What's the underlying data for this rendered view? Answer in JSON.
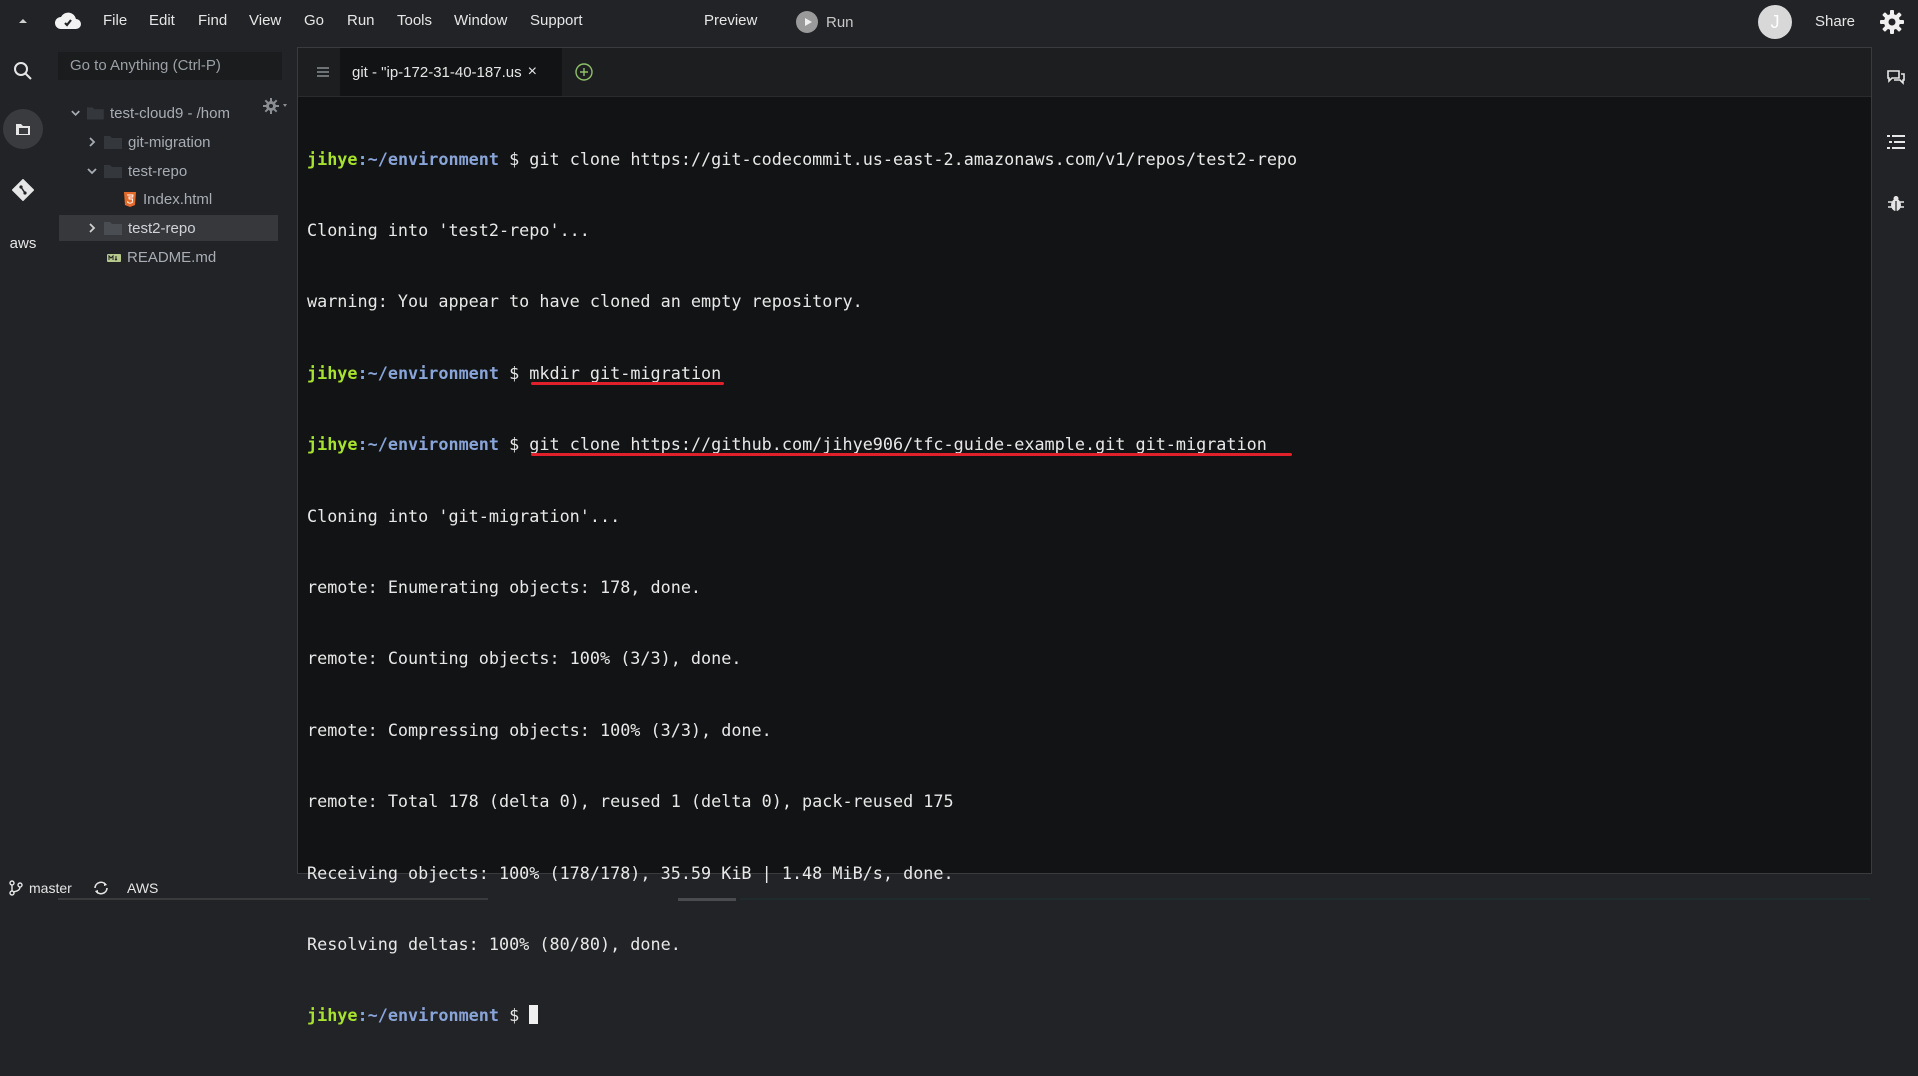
{
  "menubar": {
    "items": [
      "File",
      "Edit",
      "Find",
      "View",
      "Go",
      "Run",
      "Tools",
      "Window",
      "Support"
    ],
    "preview_label": "Preview",
    "run_label": "Run",
    "avatar_letter": "J",
    "share_label": "Share"
  },
  "sidebar": {
    "goto_placeholder": "Go to Anything (Ctrl-P)",
    "tree": [
      {
        "label": "test-cloud9 - /hom",
        "type": "folder",
        "expanded": true
      },
      {
        "label": "git-migration",
        "type": "folder",
        "expanded": false
      },
      {
        "label": "test-repo",
        "type": "folder",
        "expanded": true
      },
      {
        "label": "Index.html",
        "type": "html-file"
      },
      {
        "label": "test2-repo",
        "type": "folder",
        "expanded": false,
        "selected": true
      },
      {
        "label": "README.md",
        "type": "md-file"
      }
    ]
  },
  "activitybar": {
    "aws_label": "aws"
  },
  "editor": {
    "tab_title": "git - \"ip-172-31-40-187.us",
    "tab_close": "×"
  },
  "terminal": {
    "prompt_user": "jihye",
    "prompt_path": ":~/environment",
    "prompt_symbol": " $ ",
    "lines": [
      {
        "kind": "prompt",
        "cmd": "git clone https://git-codecommit.us-east-2.amazonaws.com/v1/repos/test2-repo"
      },
      {
        "kind": "out",
        "text": "Cloning into 'test2-repo'..."
      },
      {
        "kind": "out",
        "text": "warning: You appear to have cloned an empty repository."
      },
      {
        "kind": "prompt",
        "cmd": "mkdir git-migration",
        "underlined": true
      },
      {
        "kind": "prompt",
        "cmd": "git clone https://github.com/jihye906/tfc-guide-example.git git-migration",
        "underlined": true
      },
      {
        "kind": "out",
        "text": "Cloning into 'git-migration'..."
      },
      {
        "kind": "out",
        "text": "remote: Enumerating objects: 178, done."
      },
      {
        "kind": "out",
        "text": "remote: Counting objects: 100% (3/3), done."
      },
      {
        "kind": "out",
        "text": "remote: Compressing objects: 100% (3/3), done."
      },
      {
        "kind": "out",
        "text": "remote: Total 178 (delta 0), reused 1 (delta 0), pack-reused 175"
      },
      {
        "kind": "out",
        "text": "Receiving objects: 100% (178/178), 35.59 KiB | 1.48 MiB/s, done."
      },
      {
        "kind": "out",
        "text": "Resolving deltas: 100% (80/80), done."
      },
      {
        "kind": "prompt",
        "cmd": "",
        "cursor": true
      }
    ]
  },
  "statusbar": {
    "branch": "master",
    "aws": "AWS"
  },
  "colors": {
    "background": "#222326",
    "terminal_bg": "#121314",
    "prompt_user": "#a6e22e",
    "prompt_path": "#89a4d8",
    "underline": "#e0202a"
  }
}
